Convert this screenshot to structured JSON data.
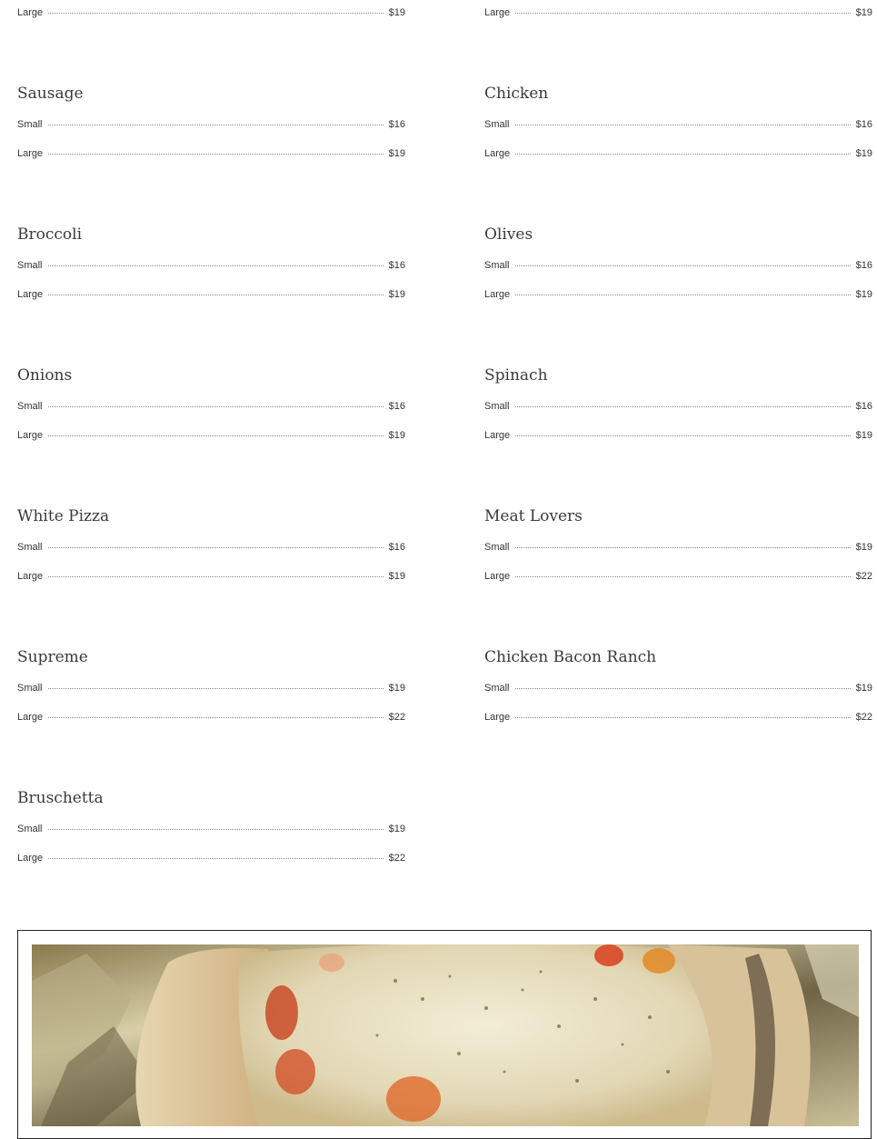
{
  "top_partial": {
    "left": {
      "size": "Large",
      "price": "$19"
    },
    "right": {
      "size": "Large",
      "price": "$19"
    }
  },
  "menu": [
    {
      "name": "Sausage",
      "small": "$16",
      "large": "$19"
    },
    {
      "name": "Chicken",
      "small": "$16",
      "large": "$19"
    },
    {
      "name": "Broccoli",
      "small": "$16",
      "large": "$19"
    },
    {
      "name": "Olives",
      "small": "$16",
      "large": "$19"
    },
    {
      "name": "Onions",
      "small": "$16",
      "large": "$19"
    },
    {
      "name": "Spinach",
      "small": "$16",
      "large": "$19"
    },
    {
      "name": "White Pizza",
      "small": "$16",
      "large": "$19"
    },
    {
      "name": "Meat Lovers",
      "small": "$19",
      "large": "$22"
    },
    {
      "name": "Supreme",
      "small": "$19",
      "large": "$22"
    },
    {
      "name": "Chicken Bacon Ranch",
      "small": "$19",
      "large": "$22"
    },
    {
      "name": "Bruschetta",
      "small": "$19",
      "large": "$22"
    }
  ],
  "labels": {
    "small": "Small",
    "large": "Large"
  },
  "colors": {
    "text": "#333333",
    "heading": "#3a3a3a",
    "dots": "#8a8a8a",
    "frame": "#222222"
  }
}
